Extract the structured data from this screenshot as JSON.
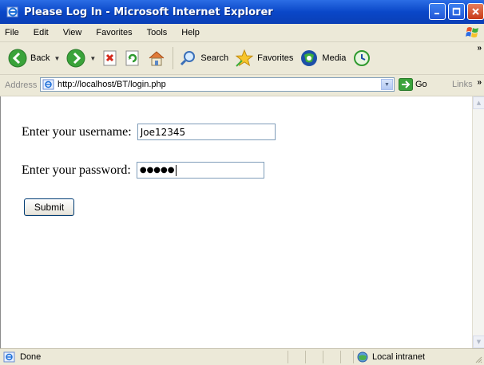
{
  "window": {
    "title": "Please Log In - Microsoft Internet Explorer"
  },
  "menu": {
    "items": [
      "File",
      "Edit",
      "View",
      "Favorites",
      "Tools",
      "Help"
    ]
  },
  "toolbar": {
    "back_label": "Back",
    "search_label": "Search",
    "favorites_label": "Favorites",
    "media_label": "Media"
  },
  "address_bar": {
    "label": "Address",
    "url": "http://localhost/BT/login.php",
    "go_label": "Go",
    "links_label": "Links"
  },
  "form": {
    "username_label": "Enter your username: ",
    "username_value": "Joe12345",
    "password_label": "Enter your password: ",
    "password_mask": "●●●●●",
    "submit_label": "Submit"
  },
  "status_bar": {
    "status_text": "Done",
    "zone_text": "Local intranet"
  },
  "colors": {
    "titlebar": "#0a47c8",
    "chrome": "#ece9d8",
    "input_border": "#7f9db9"
  }
}
